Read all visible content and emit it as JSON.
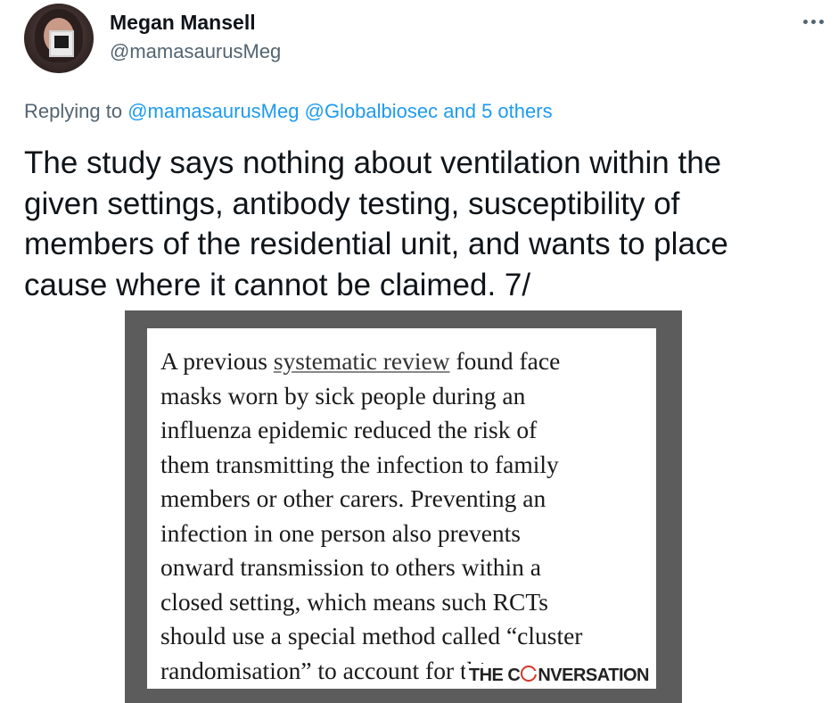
{
  "author": {
    "display_name": "Megan Mansell",
    "handle": "@mamasaurusMeg"
  },
  "menu": {
    "more_icon": "more-horizontal-icon"
  },
  "reply_context": {
    "prefix": "Replying to ",
    "mention_1": "@mamasaurusMeg",
    "mention_2": "@Globalbiosec",
    "others": "and 5 others"
  },
  "tweet": {
    "lines": [
      "The study says nothing about ventilation within the",
      "given settings, antibody testing, susceptibility of",
      "members of the residential unit, and wants to place",
      "cause where it cannot be claimed. 7/"
    ]
  },
  "media": {
    "quote": {
      "line1_pre": "A previous ",
      "line1_link": "systematic review",
      "line1_post": " found face",
      "lines": [
        "masks worn by sick people during an",
        "influenza epidemic reduced the risk of",
        "them transmitting the infection to family",
        "members or other carers. Preventing an",
        "infection in one person also prevents",
        "onward transmission to others within a",
        "closed setting, which means such RCTs",
        "should use a special method called “cluster",
        "randomisation” to account for this."
      ]
    },
    "brand": {
      "part1": "THE C",
      "part2": "NVERSATION",
      "accent_color": "#d8352a"
    }
  },
  "colors": {
    "link": "#1d9bf0",
    "secondary_text": "#536471",
    "media_frame": "#5c5c5c"
  }
}
